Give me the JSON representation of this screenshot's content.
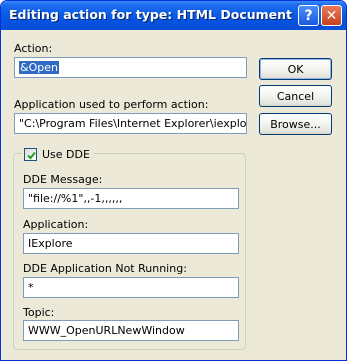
{
  "window": {
    "title": "Editing action for type: HTML Document",
    "help_glyph": "?",
    "close_glyph": "✕"
  },
  "action": {
    "label": "Action:",
    "value": "&Open"
  },
  "application_path": {
    "label": "Application used to perform action:",
    "value": "\"C:\\Program Files\\Internet Explorer\\iexplore.e"
  },
  "buttons": {
    "ok": "OK",
    "cancel": "Cancel",
    "browse": "Browse..."
  },
  "dde": {
    "checkbox_label": "Use DDE",
    "checked": true,
    "message_label": "DDE Message:",
    "message_value": "\"file://%1\",,-1,,,,,,",
    "application_label": "Application:",
    "application_value": "IExplore",
    "not_running_label": "DDE Application Not Running:",
    "not_running_value": "*",
    "topic_label": "Topic:",
    "topic_value": "WWW_OpenURLNewWindow"
  },
  "colors": {
    "title_bar": "#0a5de8",
    "dialog_bg": "#ece9d8",
    "selection": "#316ac5",
    "input_border": "#7f9db9",
    "check_mark": "#21a121"
  }
}
